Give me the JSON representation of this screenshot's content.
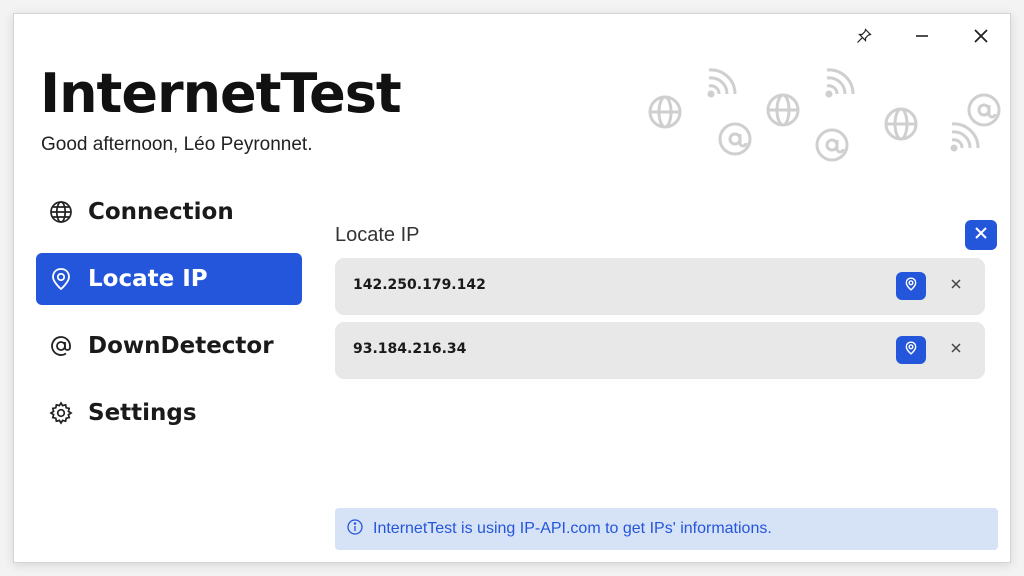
{
  "app": {
    "title": "InternetTest",
    "greeting": "Good afternoon, Léo Peyronnet."
  },
  "titlebar": {
    "pin_icon": "pin-icon",
    "minimize_icon": "minimize-icon",
    "close_icon": "close-icon"
  },
  "sidebar": {
    "items": [
      {
        "label": "Connection",
        "icon": "globe-icon",
        "active": false
      },
      {
        "label": "Locate IP",
        "icon": "location-shield-icon",
        "active": true
      },
      {
        "label": "DownDetector",
        "icon": "at-icon",
        "active": false
      },
      {
        "label": "Settings",
        "icon": "gear-icon",
        "active": false
      }
    ]
  },
  "main": {
    "section_title": "Locate IP",
    "ips": [
      {
        "address": "142.250.179.142"
      },
      {
        "address": "93.184.216.34"
      }
    ],
    "info": "InternetTest is using IP-API.com to get IPs' informations."
  },
  "colors": {
    "accent": "#2456db",
    "info_background": "#d6e2f6",
    "row_background": "#e8e8e8"
  }
}
